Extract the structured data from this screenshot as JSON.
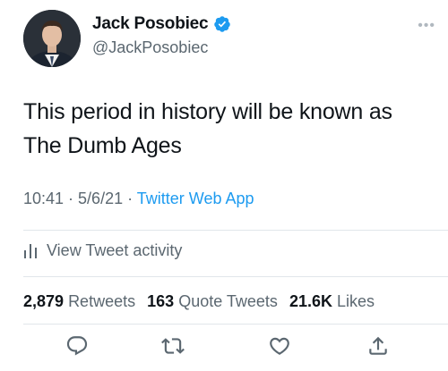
{
  "author": {
    "display_name": "Jack Posobiec",
    "handle": "@JackPosobiec",
    "verified": true,
    "avatar_icon": "profile-photo",
    "more_icon": "more-options-icon"
  },
  "tweet": {
    "text_line1": "This period in history will be known as",
    "text_line2": "The Dumb Ages"
  },
  "meta": {
    "time": "10:41",
    "sep1": " · ",
    "date": "5/6/21",
    "sep2": " · ",
    "source": "Twitter Web App"
  },
  "activity": {
    "label": "View Tweet activity",
    "icon": "bar-chart-icon"
  },
  "stats": {
    "retweets_count": "2,879",
    "retweets_label": "Retweets",
    "quotes_count": "163",
    "quotes_label": "Quote Tweets",
    "likes_count": "21.6K",
    "likes_label": "Likes"
  },
  "actions": [
    "reply-icon",
    "retweet-icon",
    "like-icon",
    "share-icon"
  ],
  "colors": {
    "accent": "#1d9bf0",
    "text": "#0f1419",
    "secondary": "#5b6770",
    "divider": "#e1e6ea"
  }
}
